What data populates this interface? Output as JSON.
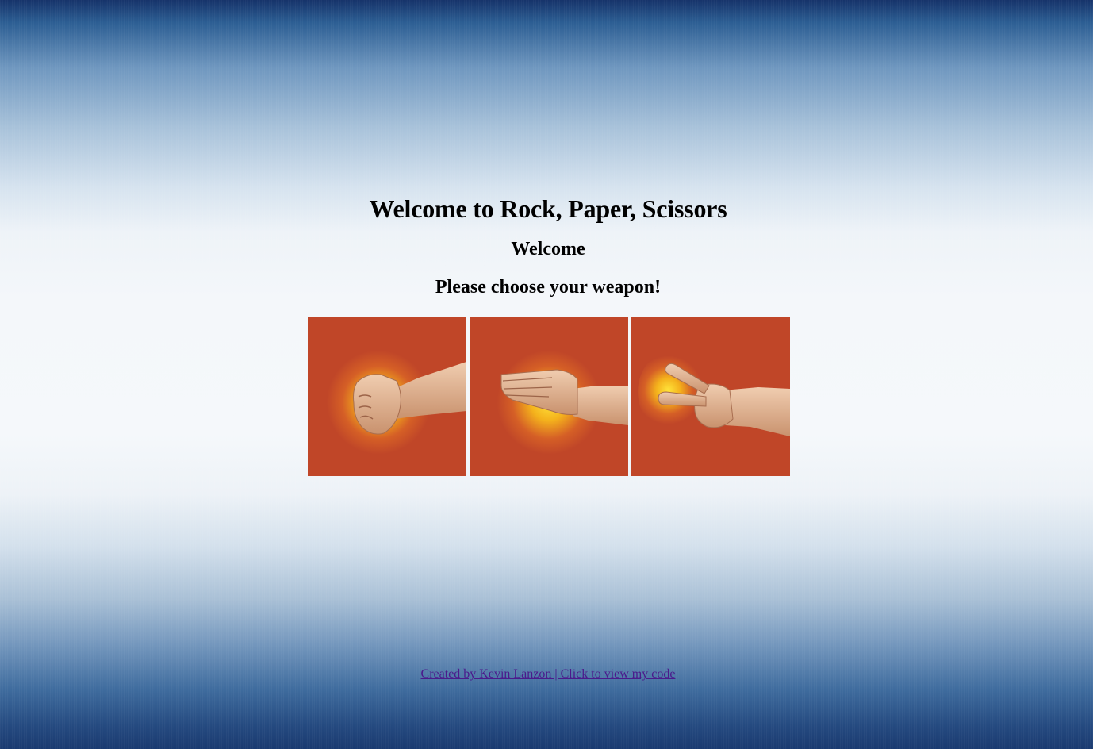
{
  "page": {
    "title": "Welcome to Rock, Paper, Scissors",
    "welcome": "Welcome",
    "prompt": "Please choose your weapon!"
  },
  "weapons": [
    {
      "name": "rock",
      "icon": "rock-fist-icon"
    },
    {
      "name": "paper",
      "icon": "paper-flat-hand-icon"
    },
    {
      "name": "scissors",
      "icon": "scissors-two-fingers-icon"
    }
  ],
  "footer": {
    "link_text": "Created by Kevin Lanzon | Click to view my code"
  },
  "colors": {
    "tile_background": "#c04628",
    "glow": "#f7c21a",
    "skin": "#e6b898",
    "link": "#4b1a8c"
  }
}
